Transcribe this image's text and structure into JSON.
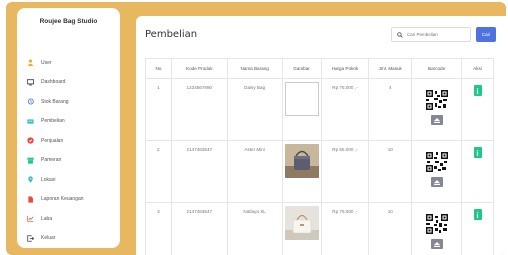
{
  "sidebar": {
    "brand": "Roujee Bag Studio",
    "items": [
      {
        "label": "User",
        "icon": "user-icon",
        "color": "#f6a623"
      },
      {
        "label": "Dashboard",
        "icon": "monitor-icon",
        "color": "#3a3b45"
      },
      {
        "label": "Stok Barang",
        "icon": "history-icon",
        "color": "#4e73df"
      },
      {
        "label": "Pembelian",
        "icon": "cart-icon",
        "color": "#36b9cc"
      },
      {
        "label": "Penjualan",
        "icon": "badge-icon",
        "color": "#e74a3b"
      },
      {
        "label": "Pameran",
        "icon": "store-icon",
        "color": "#1cc88a"
      },
      {
        "label": "Lokasi",
        "icon": "map-pin-icon",
        "color": "#36b9cc"
      },
      {
        "label": "Laporan Keuangan",
        "icon": "file-icon",
        "color": "#e74a3b"
      },
      {
        "label": "Laba",
        "icon": "chart-icon",
        "color": "#e74a3b"
      },
      {
        "label": "Keluar",
        "icon": "logout-icon",
        "color": "#3a3b45"
      }
    ]
  },
  "main": {
    "title": "Pembelian",
    "search": {
      "placeholder": "Cari Pembelian",
      "button": "Cari"
    },
    "table": {
      "headers": [
        "No",
        "Kode Produk",
        "Nama Barang",
        "Gambar",
        "Harga Pokok",
        "Jml. Masuk",
        "Barcode",
        "Aksi"
      ],
      "rows": [
        {
          "no": "1",
          "kode": "1234567890",
          "nama": "Daisy Bag",
          "harga": "Rp 75.000 ,-",
          "jumlah": "4"
        },
        {
          "no": "2",
          "kode": "2147483647",
          "nama": "Aster Mini",
          "harga": "Rp 65.000 ,-",
          "jumlah": "10"
        },
        {
          "no": "3",
          "kode": "2147483647",
          "nama": "Natlaya XL",
          "harga": "Rp 75.000 ,-",
          "jumlah": "10"
        }
      ]
    }
  },
  "colors": {
    "frame": "#e8b860",
    "primary": "#4e73df",
    "success": "#1cc88a",
    "secondary": "#858796"
  }
}
